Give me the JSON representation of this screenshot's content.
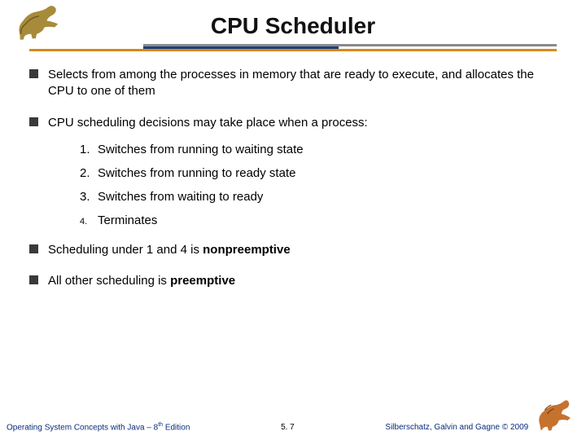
{
  "title": "CPU Scheduler",
  "bullets": {
    "b1": "Selects from among the processes in memory that are ready to execute, and allocates the CPU to one of them",
    "b2": "CPU scheduling decisions may take place when a process:",
    "b3_pre": "Scheduling under 1 and 4 is ",
    "b3_bold": "nonpreemptive",
    "b4_pre": "All other scheduling is ",
    "b4_bold": "preemptive"
  },
  "numbered": [
    {
      "n": "1.",
      "t": "Switches from running to waiting state"
    },
    {
      "n": "2.",
      "t": "Switches from running to ready state"
    },
    {
      "n": "3.",
      "t": "Switches from waiting to ready"
    },
    {
      "n": "4.",
      "t": "Terminates"
    }
  ],
  "footer": {
    "left_pre": "Operating System Concepts with Java – 8",
    "left_sup": "th",
    "left_post": " Edition",
    "page": "5. 7",
    "right": "Silberschatz, Galvin and Gagne © 2009"
  }
}
